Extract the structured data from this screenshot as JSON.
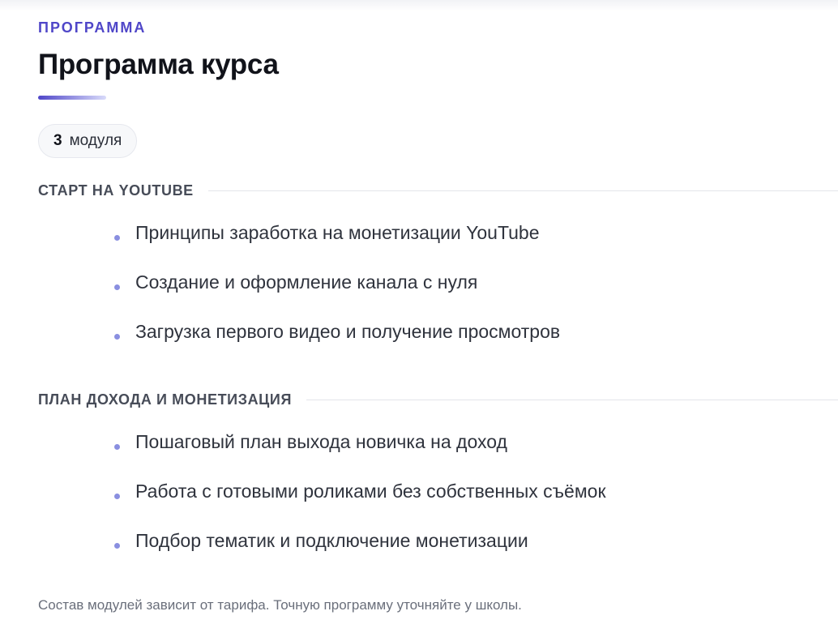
{
  "section": {
    "eyebrow": "ПРОГРАММА",
    "title": "Программа курса"
  },
  "module_count": {
    "number": "3",
    "label": "модуля"
  },
  "modules": [
    {
      "title": "СТАРТ НА YOUTUBE",
      "lessons": [
        "Принципы заработка на монетизации YouTube",
        "Создание и оформление канала с нуля",
        "Загрузка первого видео и получение просмотров"
      ]
    },
    {
      "title": "ПЛАН ДОХОДА И МОНЕТИЗАЦИЯ",
      "lessons": [
        "Пошаговый план выхода новичка на доход",
        "Работа с готовыми роликами без собственных съёмок",
        "Подбор тематик и подключение монетизации"
      ]
    }
  ],
  "footnote": "Состав модулей зависит от тарифа. Точную программу уточняйте у школы.",
  "colors": {
    "accent": "#4f46c8",
    "bullet": "#8a8fe0",
    "heading": "#11131a",
    "text": "#2f333d",
    "muted": "#6a6f7b"
  }
}
